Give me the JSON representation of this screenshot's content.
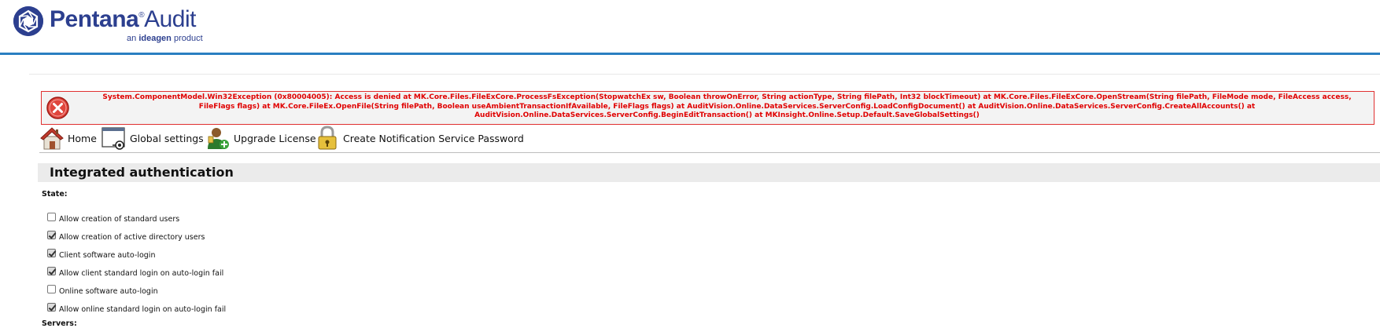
{
  "header": {
    "brand_name": "Pentana",
    "brand_mark": "®",
    "brand_product": "Audit",
    "brand_tagline_prefix": "an",
    "brand_tagline_company": "ideagen",
    "brand_tagline_suffix": "product",
    "logo_icon": "pentana-logo-icon"
  },
  "error": {
    "icon": "error-x-icon",
    "message": "System.ComponentModel.Win32Exception (0x80004005): Access is denied at MK.Core.Files.FileExCore.ProcessFsException(StopwatchEx sw, Boolean throwOnError, String actionType, String filePath, Int32 blockTimeout) at MK.Core.Files.FileExCore.OpenStream(String filePath, FileMode mode, FileAccess access, FileFlags flags) at MK.Core.FileEx.OpenFile(String filePath, Boolean useAmbientTransactionIfAvailable, FileFlags flags) at AuditVision.Online.DataServices.ServerConfig.LoadConfigDocument() at AuditVision.Online.DataServices.ServerConfig.CreateAllAccounts() at AuditVision.Online.DataServices.ServerConfig.BeginEditTransaction() at MKInsight.Online.Setup.Default.SaveGlobalSettings()",
    "color": "#e00000"
  },
  "toolbar": {
    "home": "Home",
    "global_settings": "Global settings",
    "upgrade_license": "Upgrade License",
    "create_password": "Create Notification Service Password"
  },
  "section": {
    "title": "Integrated authentication",
    "state_label": "State:",
    "servers_label": "Servers:"
  },
  "options": [
    {
      "label": "Allow creation of standard users",
      "checked": false
    },
    {
      "label": "Allow creation of active directory users",
      "checked": true
    },
    {
      "label": "Client software auto-login",
      "checked": true
    },
    {
      "label": "Allow client standard login on auto-login fail",
      "checked": true
    },
    {
      "label": "Online software auto-login",
      "checked": false
    },
    {
      "label": "Allow online standard login on auto-login fail",
      "checked": true
    }
  ],
  "colors": {
    "brand": "#2c3f8f",
    "accent_line": "#2a7fc1"
  }
}
